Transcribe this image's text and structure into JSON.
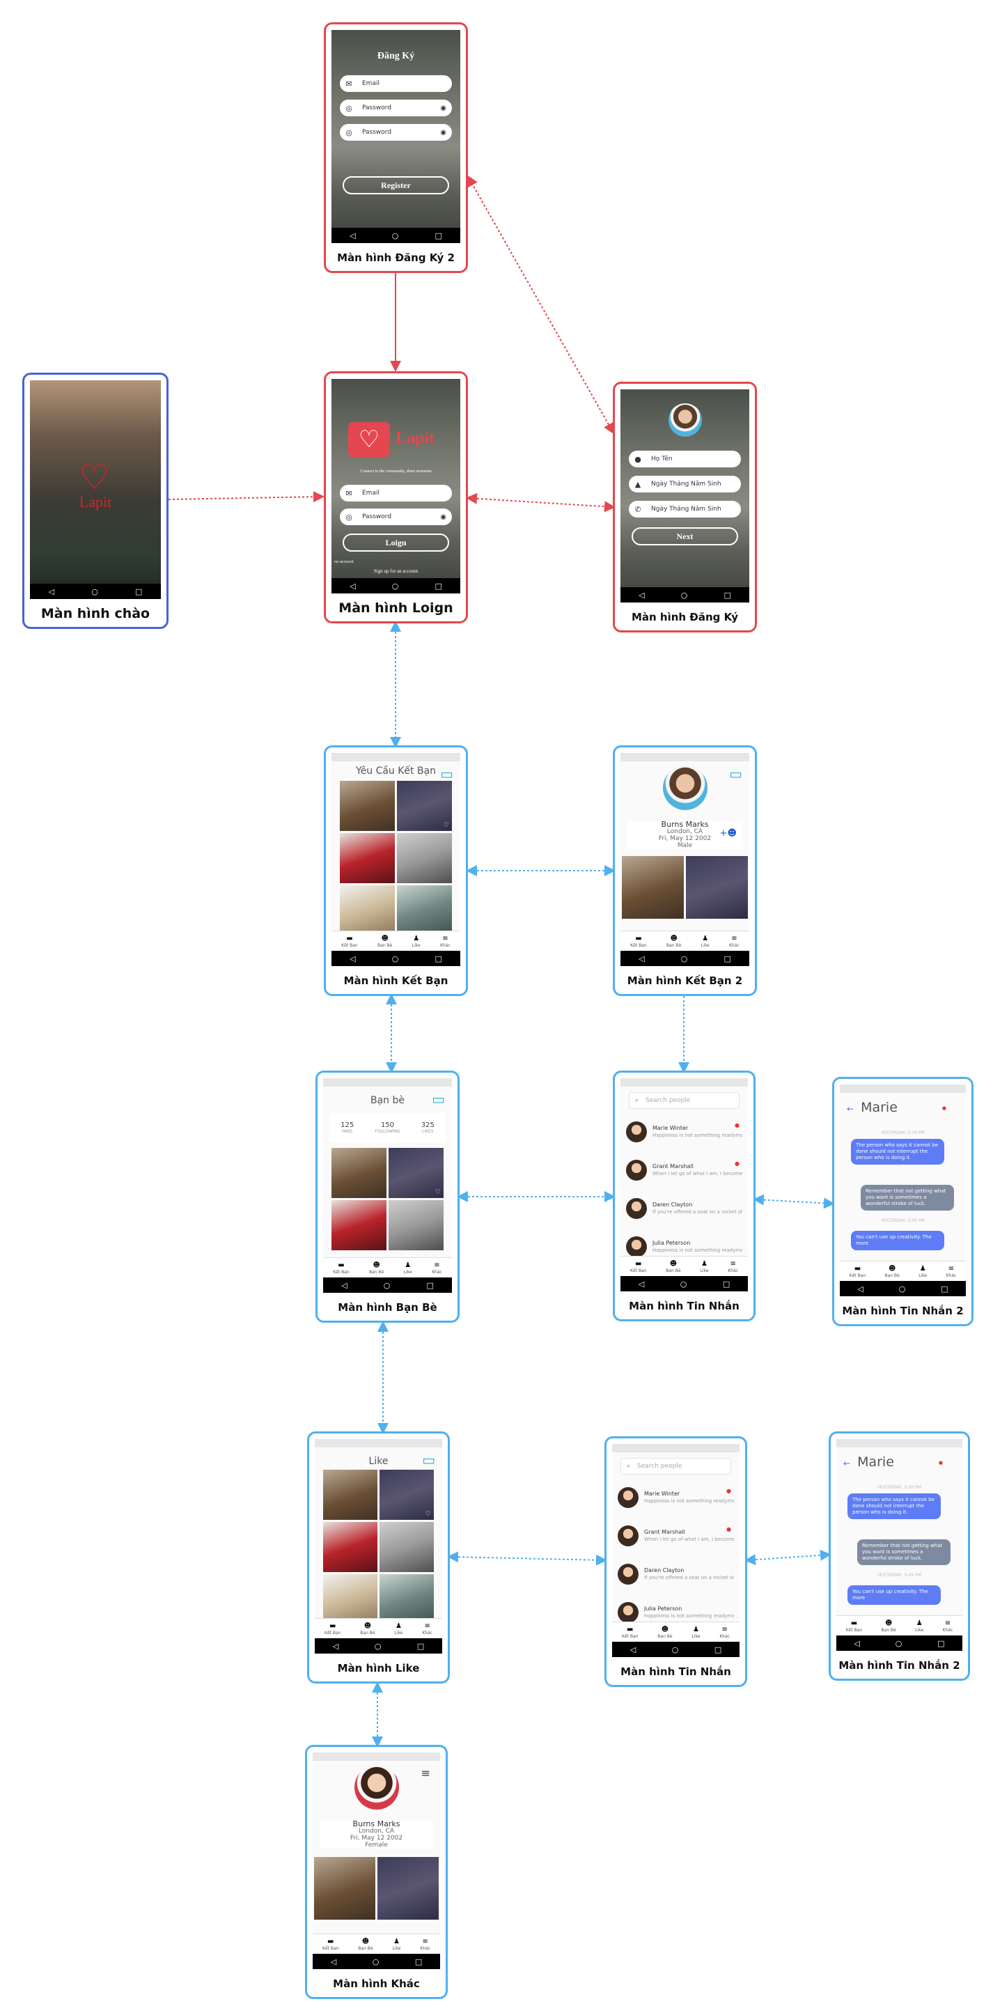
{
  "screens": {
    "welcome": {
      "caption": "Màn hình chào",
      "logo": "Lapit"
    },
    "register2": {
      "caption": "Màn hình Đăng Ký 2",
      "title": "Đăng Ký",
      "email": "Email",
      "password": "Password",
      "password2": "Password",
      "button": "Register"
    },
    "login": {
      "caption": "Màn hình Loign",
      "logo": "Lapit",
      "tagline": "Connect to the community, share moments",
      "email": "Email",
      "password": "Password",
      "button": "Loign",
      "small_link": "no account",
      "signup": "Sign up for an account"
    },
    "register": {
      "caption": "Màn hình Đăng Ký",
      "name": "Họ Tên",
      "dob": "Ngày Tháng Năm Sinh",
      "phone": "Ngày Tháng Năm Sinh",
      "button": "Next"
    },
    "friends_req": {
      "caption": "Màn hình Kết Bạn",
      "title": "Yêu Cầu Kết Bạn"
    },
    "friends_req2": {
      "caption": "Màn hình Kết Bạn 2",
      "name": "Burns Marks",
      "city": "London, CA",
      "date": "Fri, May 12 2002",
      "gender": "Male"
    },
    "friends": {
      "caption": "Màn hình Bạn Bè",
      "title": "Bạn bè",
      "stats": [
        {
          "n": "125",
          "l": "FANS"
        },
        {
          "n": "150",
          "l": "FOLLOWING"
        },
        {
          "n": "325",
          "l": "LIKES"
        }
      ]
    },
    "messages": {
      "caption": "Màn hình Tin Nhắn"
    },
    "chat": {
      "caption": "Màn hình Tin Nhắn 2"
    },
    "like": {
      "caption": "Màn hình Like",
      "title": "Like"
    },
    "messages_b": {
      "caption": "Màn hình Tin Nhắn"
    },
    "chat_b": {
      "caption": "Màn hình Tin Nhắn 2"
    },
    "other": {
      "caption": "Màn hình Khác",
      "name": "Burns Marks",
      "city": "London, CA",
      "date": "Fri, May 12 2002",
      "gender": "Female"
    }
  },
  "messages_list": {
    "search": "Search people",
    "rows": [
      {
        "name": "Marie Winter",
        "preview": "Happiness is not something readymade."
      },
      {
        "name": "Grant Marshall",
        "preview": "When I let go of what I am, I become"
      },
      {
        "name": "Daren Clayton",
        "preview": "If you're offered a seat on a rocket ship"
      },
      {
        "name": "Julia Peterson",
        "preview": "Happiness is not something readymade."
      }
    ]
  },
  "chat_data": {
    "name": "Marie",
    "ts1": "YESTERDAY, 5:30 PM",
    "m1": "The person who says it cannot be done should not interrupt the person who is doing it.",
    "m2": "Remember that not getting what you want is sometimes a wonderful stroke of luck.",
    "ts2": "YESTERDAY, 5:45 PM",
    "m3": "You can't use up creativity. The more"
  },
  "tabs": [
    "Kết Bạn",
    "Bạn Bè",
    "Like",
    "Khác"
  ],
  "photo_labels": [
    "Jacket",
    "Sunset",
    "Car",
    "Cocktail",
    "Coins",
    "Evergreen"
  ],
  "colors": {
    "red_border": "#e4474f",
    "blue_border": "#4fb0ee",
    "welcome_border": "#4a62d8",
    "accent": "#27b6d6",
    "chat_me": "#5d7cf6"
  }
}
